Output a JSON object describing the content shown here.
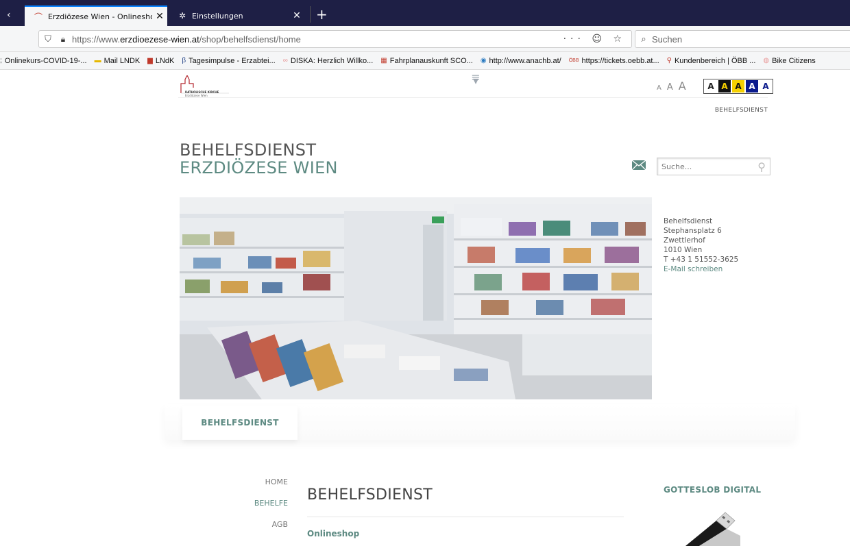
{
  "browser": {
    "tabs": [
      {
        "title": "Erzdiözese Wien - Onlineshop",
        "icon": "diocese-favicon",
        "active": true,
        "close": "✕"
      },
      {
        "title": "Einstellungen",
        "icon": "gear-icon",
        "active": false,
        "close": "✕"
      }
    ],
    "new_tab": "+",
    "url_prefix": "https://www.",
    "url_domain": "erzdioezese-wien.at",
    "url_path": "/shop/behelfsdienst/home",
    "url_actions": "··· ☺ ☆",
    "search_placeholder": "Suchen",
    "bookmarks": [
      {
        "label": "Onlinekurs-COVID-19-...",
        "icon": "page-icon"
      },
      {
        "label": "Mail LNDK",
        "icon": "folder-icon"
      },
      {
        "label": "LNdK",
        "icon": "flag-icon"
      },
      {
        "label": "Tagesimpulse - Erzabtei...",
        "icon": "b-icon"
      },
      {
        "label": "DISKA: Herzlich Willko...",
        "icon": "diska-icon"
      },
      {
        "label": "Fahrplanauskunft SCO...",
        "icon": "oebb-icon"
      },
      {
        "label": "http://www.anachb.at/",
        "icon": "anachb-icon"
      },
      {
        "label": "https://tickets.oebb.at...",
        "icon": "oebb-icon"
      },
      {
        "label": "Kundenbereich | ÖBB ...",
        "icon": "location-pin-icon"
      },
      {
        "label": "Bike Citizens",
        "icon": "bike-icon"
      }
    ]
  },
  "header": {
    "logo_line1": "KATHOLISCHE KIRCHE",
    "logo_line2": "Erzdiözese Wien",
    "font_sizes": [
      "A",
      "A",
      "A"
    ],
    "contrast_options": [
      "A",
      "A",
      "A",
      "A",
      "A"
    ],
    "top_link": "BEHELFSDIENST"
  },
  "site": {
    "title_line1": "BEHELFSDIENST",
    "title_line2": "ERZDIÖZESE WIEN",
    "search_placeholder": "Suche..."
  },
  "contact": {
    "name": "Behelfsdienst",
    "street": "Stephansplatz 6",
    "building": "Zwettlerhof",
    "city": "1010 Wien",
    "phone": "T +43 1 51552-3625",
    "email_link": "E-Mail schreiben"
  },
  "section_tab": "BEHELFSDIENST",
  "leftnav": [
    "HOME",
    "BEHELFE",
    "AGB"
  ],
  "main": {
    "heading": "BEHELFSDIENST",
    "subheading": "Onlineshop"
  },
  "sidebar": {
    "heading": "GOTTESLOB DIGITAL"
  },
  "colors": {
    "accent": "#5d8a82",
    "tabbar": "#1e1f45"
  }
}
